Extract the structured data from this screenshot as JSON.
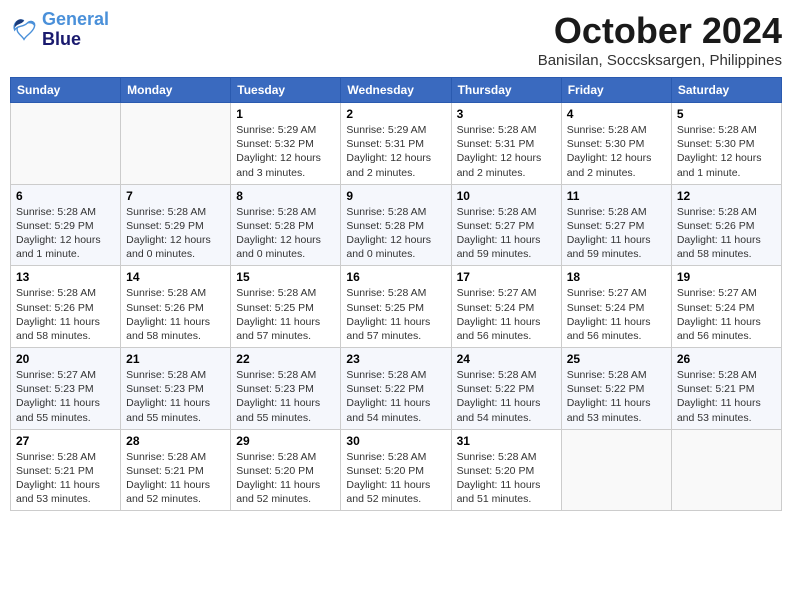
{
  "logo": {
    "line1": "General",
    "line2": "Blue"
  },
  "title": "October 2024",
  "subtitle": "Banisilan, Soccsksargen, Philippines",
  "days_header": [
    "Sunday",
    "Monday",
    "Tuesday",
    "Wednesday",
    "Thursday",
    "Friday",
    "Saturday"
  ],
  "weeks": [
    [
      {
        "day": "",
        "info": ""
      },
      {
        "day": "",
        "info": ""
      },
      {
        "day": "1",
        "info": "Sunrise: 5:29 AM\nSunset: 5:32 PM\nDaylight: 12 hours and 3 minutes."
      },
      {
        "day": "2",
        "info": "Sunrise: 5:29 AM\nSunset: 5:31 PM\nDaylight: 12 hours and 2 minutes."
      },
      {
        "day": "3",
        "info": "Sunrise: 5:28 AM\nSunset: 5:31 PM\nDaylight: 12 hours and 2 minutes."
      },
      {
        "day": "4",
        "info": "Sunrise: 5:28 AM\nSunset: 5:30 PM\nDaylight: 12 hours and 2 minutes."
      },
      {
        "day": "5",
        "info": "Sunrise: 5:28 AM\nSunset: 5:30 PM\nDaylight: 12 hours and 1 minute."
      }
    ],
    [
      {
        "day": "6",
        "info": "Sunrise: 5:28 AM\nSunset: 5:29 PM\nDaylight: 12 hours and 1 minute."
      },
      {
        "day": "7",
        "info": "Sunrise: 5:28 AM\nSunset: 5:29 PM\nDaylight: 12 hours and 0 minutes."
      },
      {
        "day": "8",
        "info": "Sunrise: 5:28 AM\nSunset: 5:28 PM\nDaylight: 12 hours and 0 minutes."
      },
      {
        "day": "9",
        "info": "Sunrise: 5:28 AM\nSunset: 5:28 PM\nDaylight: 12 hours and 0 minutes."
      },
      {
        "day": "10",
        "info": "Sunrise: 5:28 AM\nSunset: 5:27 PM\nDaylight: 11 hours and 59 minutes."
      },
      {
        "day": "11",
        "info": "Sunrise: 5:28 AM\nSunset: 5:27 PM\nDaylight: 11 hours and 59 minutes."
      },
      {
        "day": "12",
        "info": "Sunrise: 5:28 AM\nSunset: 5:26 PM\nDaylight: 11 hours and 58 minutes."
      }
    ],
    [
      {
        "day": "13",
        "info": "Sunrise: 5:28 AM\nSunset: 5:26 PM\nDaylight: 11 hours and 58 minutes."
      },
      {
        "day": "14",
        "info": "Sunrise: 5:28 AM\nSunset: 5:26 PM\nDaylight: 11 hours and 58 minutes."
      },
      {
        "day": "15",
        "info": "Sunrise: 5:28 AM\nSunset: 5:25 PM\nDaylight: 11 hours and 57 minutes."
      },
      {
        "day": "16",
        "info": "Sunrise: 5:28 AM\nSunset: 5:25 PM\nDaylight: 11 hours and 57 minutes."
      },
      {
        "day": "17",
        "info": "Sunrise: 5:27 AM\nSunset: 5:24 PM\nDaylight: 11 hours and 56 minutes."
      },
      {
        "day": "18",
        "info": "Sunrise: 5:27 AM\nSunset: 5:24 PM\nDaylight: 11 hours and 56 minutes."
      },
      {
        "day": "19",
        "info": "Sunrise: 5:27 AM\nSunset: 5:24 PM\nDaylight: 11 hours and 56 minutes."
      }
    ],
    [
      {
        "day": "20",
        "info": "Sunrise: 5:27 AM\nSunset: 5:23 PM\nDaylight: 11 hours and 55 minutes."
      },
      {
        "day": "21",
        "info": "Sunrise: 5:28 AM\nSunset: 5:23 PM\nDaylight: 11 hours and 55 minutes."
      },
      {
        "day": "22",
        "info": "Sunrise: 5:28 AM\nSunset: 5:23 PM\nDaylight: 11 hours and 55 minutes."
      },
      {
        "day": "23",
        "info": "Sunrise: 5:28 AM\nSunset: 5:22 PM\nDaylight: 11 hours and 54 minutes."
      },
      {
        "day": "24",
        "info": "Sunrise: 5:28 AM\nSunset: 5:22 PM\nDaylight: 11 hours and 54 minutes."
      },
      {
        "day": "25",
        "info": "Sunrise: 5:28 AM\nSunset: 5:22 PM\nDaylight: 11 hours and 53 minutes."
      },
      {
        "day": "26",
        "info": "Sunrise: 5:28 AM\nSunset: 5:21 PM\nDaylight: 11 hours and 53 minutes."
      }
    ],
    [
      {
        "day": "27",
        "info": "Sunrise: 5:28 AM\nSunset: 5:21 PM\nDaylight: 11 hours and 53 minutes."
      },
      {
        "day": "28",
        "info": "Sunrise: 5:28 AM\nSunset: 5:21 PM\nDaylight: 11 hours and 52 minutes."
      },
      {
        "day": "29",
        "info": "Sunrise: 5:28 AM\nSunset: 5:20 PM\nDaylight: 11 hours and 52 minutes."
      },
      {
        "day": "30",
        "info": "Sunrise: 5:28 AM\nSunset: 5:20 PM\nDaylight: 11 hours and 52 minutes."
      },
      {
        "day": "31",
        "info": "Sunrise: 5:28 AM\nSunset: 5:20 PM\nDaylight: 11 hours and 51 minutes."
      },
      {
        "day": "",
        "info": ""
      },
      {
        "day": "",
        "info": ""
      }
    ]
  ]
}
